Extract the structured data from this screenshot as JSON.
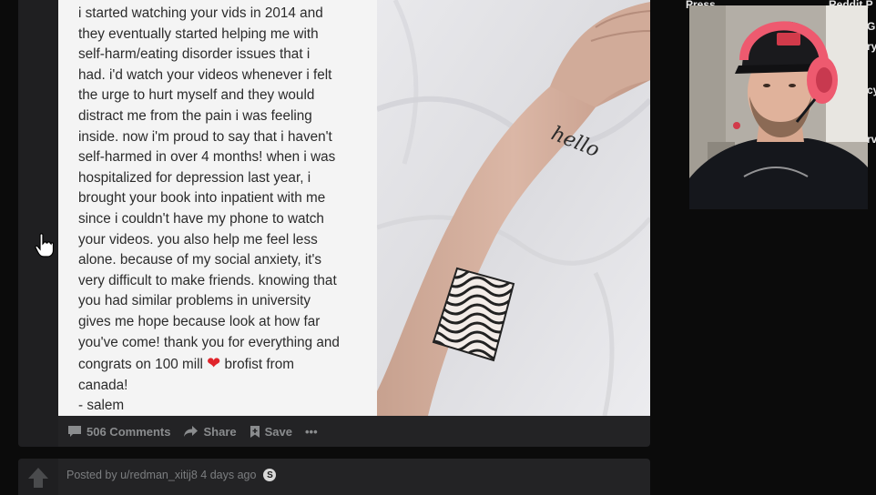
{
  "post": {
    "message": "i started watching your vids in 2014 and\nthey eventually started helping me with\nself-harm/eating disorder issues that i\nhad. i'd watch your videos whenever i felt\nthe urge to hurt myself and they would\ndistract me from the pain i was feeling\ninside. now i'm proud to say that i haven't\nself-harmed in over 4 months! when i was\nhospitalized for depression last year, i\nbrought your book into inpatient with me\nsince i couldn't have my phone to watch\nyour videos. you also help me feel less\nalone. because of my social anxiety, it's\nvery difficult to make friends. knowing that\nyou had similar problems in university\ngives me hope because look at how far\nyou've come! thank you for everything and\ncongrats on 100 mill",
    "message_tail": " brofist from\ncanada!",
    "signature": "  -  salem",
    "heart_glyph": "❤",
    "tattoo_text": "hello",
    "actions": {
      "comments": "506 Comments",
      "share": "Share",
      "save": "Save",
      "more": "•••"
    }
  },
  "post2": {
    "meta": "Posted by u/redman_xitij8 4 days ago",
    "award": "S"
  },
  "right_labels": [
    "Press",
    "Reddit P",
    "G",
    "ry",
    "cy",
    "rv"
  ],
  "colors": {
    "accent_heart": "#e0242b",
    "card_bg": "#232325",
    "page_bg": "#0b0b0b",
    "headphones": "#ee5a6f"
  }
}
